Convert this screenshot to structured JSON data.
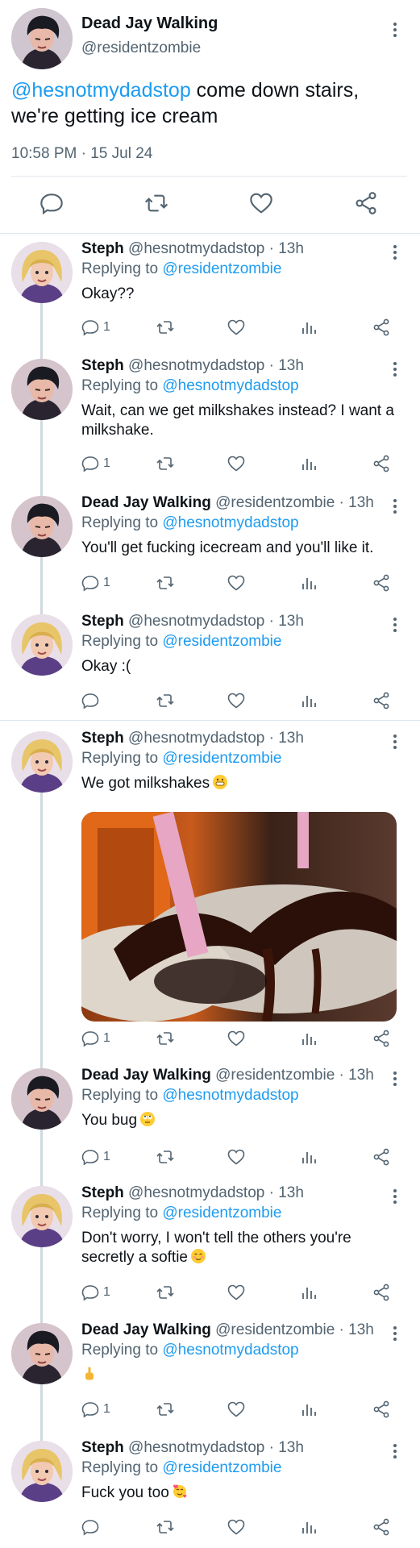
{
  "main_tweet": {
    "author_name": "Dead Jay Walking",
    "author_handle": "@residentzombie",
    "mention": "@hesnotmydadstop",
    "text": " come down stairs, we're getting ice cream",
    "timestamp": "10:58 PM · 15 Jul 24"
  },
  "replies": [
    {
      "name": "Steph",
      "meta": " @hesnotmydadstop · 13h",
      "replying_prefix": "Replying to ",
      "replying_to": "@residentzombie",
      "text": "Okay??",
      "reply_count": "1"
    },
    {
      "name": "Steph",
      "meta": " @hesnotmydadstop · 13h",
      "replying_prefix": "Replying to ",
      "replying_to": "@hesnotmydadstop",
      "text": "Wait, can we get milkshakes instead? I want a milkshake.",
      "reply_count": "1"
    },
    {
      "name": "Dead Jay Walking",
      "meta": " @residentzombie · 13h",
      "replying_prefix": "Replying to ",
      "replying_to": "@hesnotmydadstop",
      "text": "You'll get fucking icecream and you'll like it.",
      "reply_count": "1"
    },
    {
      "name": "Steph",
      "meta": " @hesnotmydadstop · 13h",
      "replying_prefix": "Replying to ",
      "replying_to": "@residentzombie",
      "text": "Okay :(",
      "reply_count": ""
    },
    {
      "name": "Steph",
      "meta": " @hesnotmydadstop · 13h",
      "replying_prefix": "Replying to ",
      "replying_to": "@residentzombie",
      "text": "We got milkshakes",
      "emoji": "grinning-face-emoji",
      "reply_count": "1"
    },
    {
      "name": "Dead Jay Walking",
      "meta": " @residentzombie · 13h",
      "replying_prefix": "Replying to ",
      "replying_to": "@hesnotmydadstop",
      "text": "You bug",
      "emoji": "eye-roll-emoji",
      "reply_count": "1"
    },
    {
      "name": "Steph",
      "meta": " @hesnotmydadstop · 13h",
      "replying_prefix": "Replying to ",
      "replying_to": "@residentzombie",
      "text": "Don't worry, I won't tell the others you're secretly a softie",
      "emoji": "smiling-face-emoji",
      "reply_count": "1"
    },
    {
      "name": "Dead Jay Walking",
      "meta": " @residentzombie · 13h",
      "replying_prefix": "Replying to ",
      "replying_to": "@hesnotmydadstop",
      "text": "",
      "emoji": "middle-finger-emoji",
      "reply_count": "1"
    },
    {
      "name": "Steph",
      "meta": " @hesnotmydadstop · 13h",
      "replying_prefix": "Replying to ",
      "replying_to": "@residentzombie",
      "text": "Fuck you too",
      "emoji": "smiling-face-with-hearts-emoji",
      "reply_count": ""
    }
  ],
  "colors": {
    "link": "#1d9bf0",
    "secondary_text": "#536471",
    "thread_line": "#cfd9de",
    "divider": "#e1e8ed"
  },
  "icons": [
    "more-icon",
    "reply-icon",
    "retweet-icon",
    "like-icon",
    "views-icon",
    "share-icon"
  ]
}
